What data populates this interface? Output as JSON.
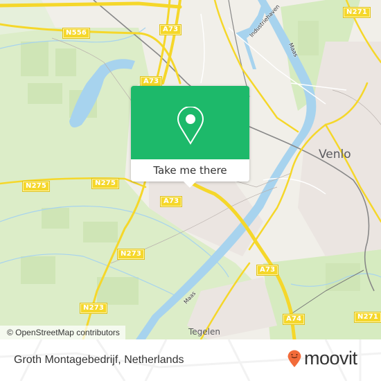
{
  "map": {
    "road_labels": [
      {
        "id": "n556",
        "text": "N556"
      },
      {
        "id": "a73-top",
        "text": "A73"
      },
      {
        "id": "a73-upper",
        "text": "A73"
      },
      {
        "id": "n271",
        "text": "N271"
      },
      {
        "id": "n275-left",
        "text": "N275"
      },
      {
        "id": "n275-mid",
        "text": "N275"
      },
      {
        "id": "a73-mid",
        "text": "A73"
      },
      {
        "id": "n273-mid",
        "text": "N273"
      },
      {
        "id": "a73-lower",
        "text": "A73"
      },
      {
        "id": "n273-low",
        "text": "N273"
      },
      {
        "id": "a74",
        "text": "A74"
      },
      {
        "id": "n271-low",
        "text": "N271"
      }
    ],
    "place_labels": {
      "venlo": "Venlo",
      "tegelen": "Tegelen"
    },
    "water_labels": {
      "maas_top": "Maas",
      "industriehaven": "Industriehaven",
      "maas_bottom": "Maas"
    },
    "attribution": "© OpenStreetMap contributors"
  },
  "popup": {
    "icon": "map-pin-icon",
    "button_label": "Take me there"
  },
  "footer": {
    "title": "Groth Montagebedrijf, Netherlands",
    "brand": "moovit",
    "brand_icon": "moovit-pin-logo-icon"
  },
  "colors": {
    "popup_green": "#1db96a",
    "road_yellow": "#f5d72a",
    "water": "#a7d3ee",
    "park": "#d6ebc0",
    "brand_orange": "#f26b3a"
  }
}
